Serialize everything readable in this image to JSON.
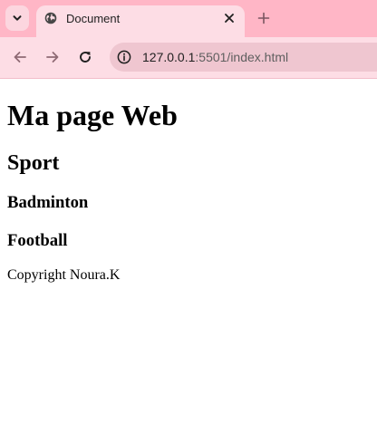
{
  "browser": {
    "tab": {
      "title": "Document",
      "favicon_icon": "globe-icon",
      "close_icon": "close-icon"
    },
    "tab_list_icon": "chevron-down-icon",
    "new_tab_icon": "plus-icon",
    "toolbar": {
      "back_icon": "arrow-left-icon",
      "forward_icon": "arrow-right-icon",
      "reload_icon": "reload-icon",
      "site_info_icon": "info-icon",
      "url_host": "127.0.0.1",
      "url_rest": ":5501/index.html"
    },
    "colors": {
      "tabstrip": "#ffb6c6",
      "active_tab": "#fddde5",
      "omnibox": "#efc6d0"
    }
  },
  "page": {
    "h1": "Ma page Web",
    "h2": "Sport",
    "items": [
      "Badminton",
      "Football"
    ],
    "footer": "Copyright Noura.K"
  }
}
